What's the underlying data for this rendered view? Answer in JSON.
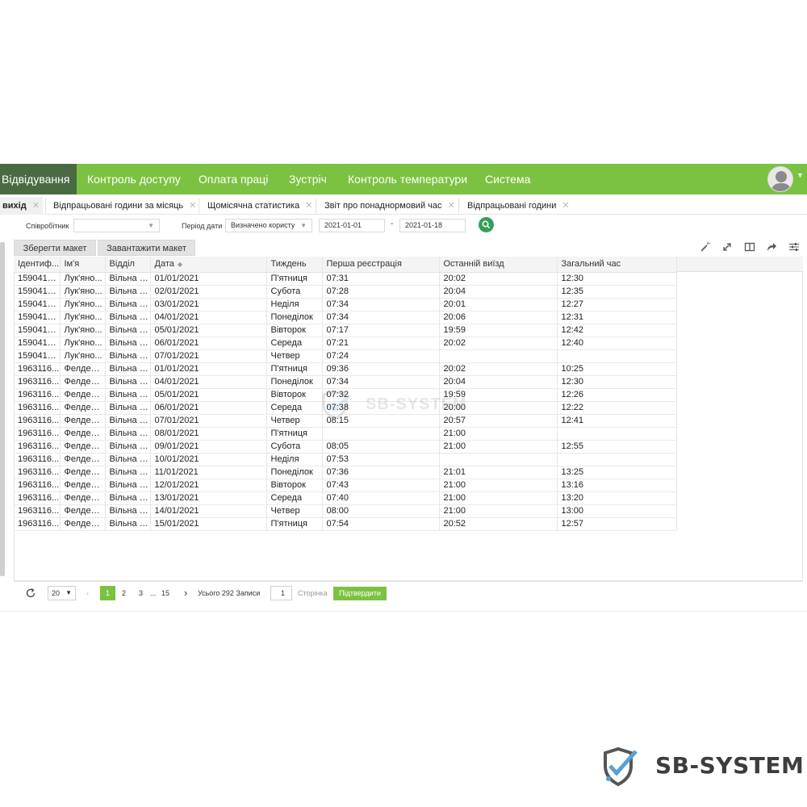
{
  "nav": {
    "active": "Відвідування",
    "items": [
      "Контроль доступу",
      "Оплата праці",
      "Зустріч",
      "Контроль температури",
      "Система"
    ]
  },
  "tabs": [
    {
      "label": "вихід"
    },
    {
      "label": "Відпрацьовані години за місяць"
    },
    {
      "label": "Щомісячна статистика"
    },
    {
      "label": "Звіт про понаднормовий час"
    },
    {
      "label": "Відпрацьовані години"
    }
  ],
  "filters": {
    "employee_label": "Співробітник",
    "employee_value": "",
    "period_label": "Період дати",
    "period_value": "Визначено користу",
    "date_from": "2021-01-01",
    "date_separator": "-",
    "date_to": "2021-01-18"
  },
  "layout_buttons": {
    "save": "Зберегти макет",
    "load": "Завантажити макет"
  },
  "grid": {
    "columns": [
      "Ідентиф...",
      "Ім'я",
      "Відділ",
      "Дата",
      "Тиждень",
      "Перша реєстрація",
      "Останній виїзд",
      "Загальний час"
    ],
    "rows": [
      [
        "1590414...",
        "Лук'яно...",
        "Вільна У...",
        "01/01/2021",
        "П'ятниця",
        "07:31",
        "20:02",
        "12:30"
      ],
      [
        "1590414...",
        "Лук'яно...",
        "Вільна У...",
        "02/01/2021",
        "Субота",
        "07:28",
        "20:04",
        "12:35"
      ],
      [
        "1590414...",
        "Лук'яно...",
        "Вільна У...",
        "03/01/2021",
        "Неділя",
        "07:34",
        "20:01",
        "12:27"
      ],
      [
        "1590414...",
        "Лук'яно...",
        "Вільна У...",
        "04/01/2021",
        "Понеділок",
        "07:34",
        "20:06",
        "12:31"
      ],
      [
        "1590414...",
        "Лук'яно...",
        "Вільна У...",
        "05/01/2021",
        "Вівторок",
        "07:17",
        "19:59",
        "12:42"
      ],
      [
        "1590414...",
        "Лук'яно...",
        "Вільна У...",
        "06/01/2021",
        "Середа",
        "07:21",
        "20:02",
        "12:40"
      ],
      [
        "1590414...",
        "Лук'яно...",
        "Вільна У...",
        "07/01/2021",
        "Четвер",
        "07:24",
        "",
        ""
      ],
      [
        "1963116...",
        "Фелдеш...",
        "Вільна У...",
        "01/01/2021",
        "П'ятниця",
        "09:36",
        "20:02",
        "10:25"
      ],
      [
        "1963116...",
        "Фелдеш...",
        "Вільна У...",
        "04/01/2021",
        "Понеділок",
        "07:34",
        "20:04",
        "12:30"
      ],
      [
        "1963116...",
        "Фелдеш...",
        "Вільна У...",
        "05/01/2021",
        "Вівторок",
        "07:32",
        "19:59",
        "12:26"
      ],
      [
        "1963116...",
        "Фелдеш...",
        "Вільна У...",
        "06/01/2021",
        "Середа",
        "07:38",
        "20:00",
        "12:22"
      ],
      [
        "1963116...",
        "Фелдеш...",
        "Вільна У...",
        "07/01/2021",
        "Четвер",
        "08:15",
        "20:57",
        "12:41"
      ],
      [
        "1963116...",
        "Фелдеш...",
        "Вільна У...",
        "08/01/2021",
        "П'ятниця",
        "",
        "21:00",
        ""
      ],
      [
        "1963116...",
        "Фелдеш...",
        "Вільна У...",
        "09/01/2021",
        "Субота",
        "08:05",
        "21:00",
        "12:55"
      ],
      [
        "1963116...",
        "Фелдеш...",
        "Вільна У...",
        "10/01/2021",
        "Неділя",
        "07:53",
        "",
        ""
      ],
      [
        "1963116...",
        "Фелдеш...",
        "Вільна У...",
        "11/01/2021",
        "Понеділок",
        "07:36",
        "21:01",
        "13:25"
      ],
      [
        "1963116...",
        "Фелдеш...",
        "Вільна У...",
        "12/01/2021",
        "Вівторок",
        "07:43",
        "21:00",
        "13:16"
      ],
      [
        "1963116...",
        "Фелдеш...",
        "Вільна У...",
        "13/01/2021",
        "Середа",
        "07:40",
        "21:00",
        "13:20"
      ],
      [
        "1963116...",
        "Фелдеш...",
        "Вільна У...",
        "14/01/2021",
        "Четвер",
        "08:00",
        "21:00",
        "13:00"
      ],
      [
        "1963116...",
        "Фелдеш...",
        "Вільна У...",
        "15/01/2021",
        "П'ятниця",
        "07:54",
        "20:52",
        "12:57"
      ]
    ]
  },
  "watermark": "SB-SYSTEM",
  "pagination": {
    "page_size": "20",
    "current_page": "1",
    "pages": [
      "2",
      "3"
    ],
    "ellipsis": "...",
    "last_page": "15",
    "total": "Усього 292 Записи",
    "goto_value": "1",
    "page_label": "Сторінка",
    "confirm": "Підтвердити"
  },
  "brand": {
    "name": "SB-SYSTEM",
    "colors": {
      "check": "#5aa0d4",
      "shield": "#555555"
    }
  },
  "colors": {
    "nav_green": "#7cc242",
    "nav_active": "#4a6b42",
    "search_button": "#33a05a"
  }
}
